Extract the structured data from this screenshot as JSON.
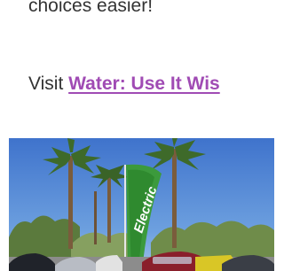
{
  "article": {
    "body_text_fragment": "choices easier!",
    "visit_prefix": "Visit ",
    "visit_link_text": "Water: Use It Wis",
    "colors": {
      "text": "#333333",
      "link": "#a04bb4"
    }
  },
  "photo": {
    "description_icon": "photo-image",
    "banner_text": "Electric"
  }
}
